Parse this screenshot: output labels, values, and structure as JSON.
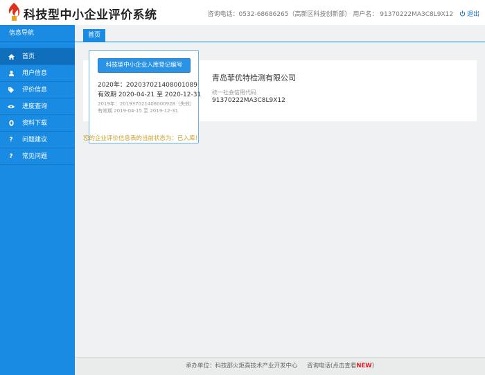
{
  "header": {
    "app_title": "科技型中小企业评价系统",
    "contact": "咨询电话：0532-68686265（高新区科技创新部）",
    "username_label": "用户名：",
    "username": "91370222MA3C8L9X12",
    "logout_label": "退出"
  },
  "sidebar": {
    "heading": "信息导航",
    "items": [
      {
        "label": "首页",
        "icon": "home-icon"
      },
      {
        "label": "用户信息",
        "icon": "user-icon"
      },
      {
        "label": "评价信息",
        "icon": "tag-icon"
      },
      {
        "label": "进度查询",
        "icon": "eye-icon"
      },
      {
        "label": "资料下载",
        "icon": "download-icon"
      },
      {
        "label": "问题建议",
        "icon": "question-icon"
      },
      {
        "label": "常见问题",
        "icon": "question-icon"
      }
    ]
  },
  "tabs": [
    {
      "label": "首页"
    }
  ],
  "registration": {
    "button_label": "科技型中小企业入库登记编号",
    "current_line": "2020年：202037021408001089",
    "current_validity": "有效期 2020-04-21 至 2020-12-31",
    "old_line": "2019年：201937021408000928（失效）",
    "old_validity": "有效期 2019-04-15 至 2019-12-31"
  },
  "company": {
    "name": "青岛菲优特检测有限公司",
    "credit_label": "统一社会信用代码",
    "credit_code": "91370222MA3C8L9X12"
  },
  "status_text": "您的企业评价信息表的当前状态为：已入库！",
  "footer": {
    "organizer": "承办单位：科技部火炬高技术产业开发中心",
    "hotline": "咨询电话(点击查看",
    "new_badge": "NEW",
    "hotline_close": ")"
  },
  "colors": {
    "sidebar": "#1a8be3",
    "accent": "#2b93e6",
    "status": "#c9a227",
    "new_badge": "#e02020"
  }
}
